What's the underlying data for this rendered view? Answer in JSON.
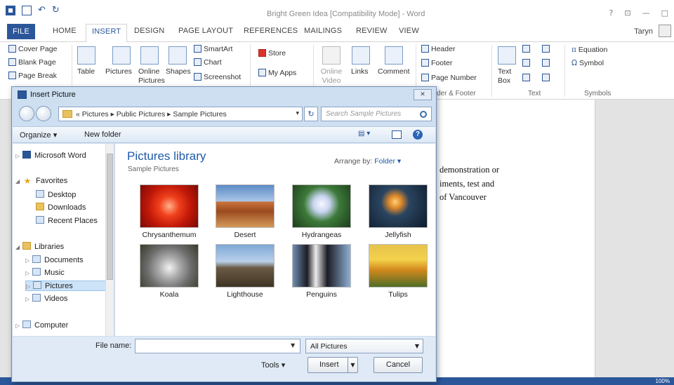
{
  "window": {
    "title": "Bright Green Idea [Compatibility Mode] - Word",
    "controls": [
      "?",
      "⊡",
      "—",
      "□"
    ],
    "user": "Taryn"
  },
  "tabs": [
    "FILE",
    "HOME",
    "INSERT",
    "DESIGN",
    "PAGE LAYOUT",
    "REFERENCES",
    "MAILINGS",
    "REVIEW",
    "VIEW"
  ],
  "ribbon": {
    "pages": [
      "Cover Page",
      "Blank Page",
      "Page Break"
    ],
    "table": "Table",
    "pictures": "Pictures",
    "online_pictures": "Online Pictures",
    "shapes": "Shapes",
    "smartart": "SmartArt",
    "chart": "Chart",
    "screenshot": "Screenshot",
    "store": "Store",
    "my_apps": "My Apps",
    "online_video": "Online Video",
    "links": "Links",
    "comment": "Comment",
    "header": "Header",
    "footer": "Footer",
    "page_number": "Page Number",
    "header_footer_group": "der & Footer",
    "text_box": "Text Box",
    "text_group": "Text",
    "equation": "Equation",
    "symbol": "Symbol",
    "symbols_group": "Symbols"
  },
  "document": {
    "lines": [
      "demonstration or",
      "iments, test and",
      "of Vancouver"
    ]
  },
  "statusbar": {
    "zoom": "100%"
  },
  "dialog": {
    "title": "Insert Picture",
    "close": "✕",
    "address": "« Pictures ▸ Public Pictures ▸ Sample Pictures",
    "search_placeholder": "Search Sample Pictures",
    "organize": "Organize ▾",
    "new_folder": "New folder",
    "nav": {
      "word": "Microsoft Word",
      "favorites": "Favorites",
      "desktop": "Desktop",
      "downloads": "Downloads",
      "recent": "Recent Places",
      "libraries": "Libraries",
      "documents": "Documents",
      "music": "Music",
      "pictures": "Pictures",
      "videos": "Videos",
      "computer": "Computer"
    },
    "library_title": "Pictures library",
    "library_sub": "Sample Pictures",
    "arrange_label": "Arrange by:",
    "arrange_value": "Folder ▾",
    "thumbnails": [
      "Chrysanthemum",
      "Desert",
      "Hydrangeas",
      "Jellyfish",
      "Koala",
      "Lighthouse",
      "Penguins",
      "Tulips"
    ],
    "file_name_label": "File name:",
    "file_name_value": "",
    "filter": "All Pictures",
    "tools": "Tools ▾",
    "insert": "Insert",
    "cancel": "Cancel"
  }
}
